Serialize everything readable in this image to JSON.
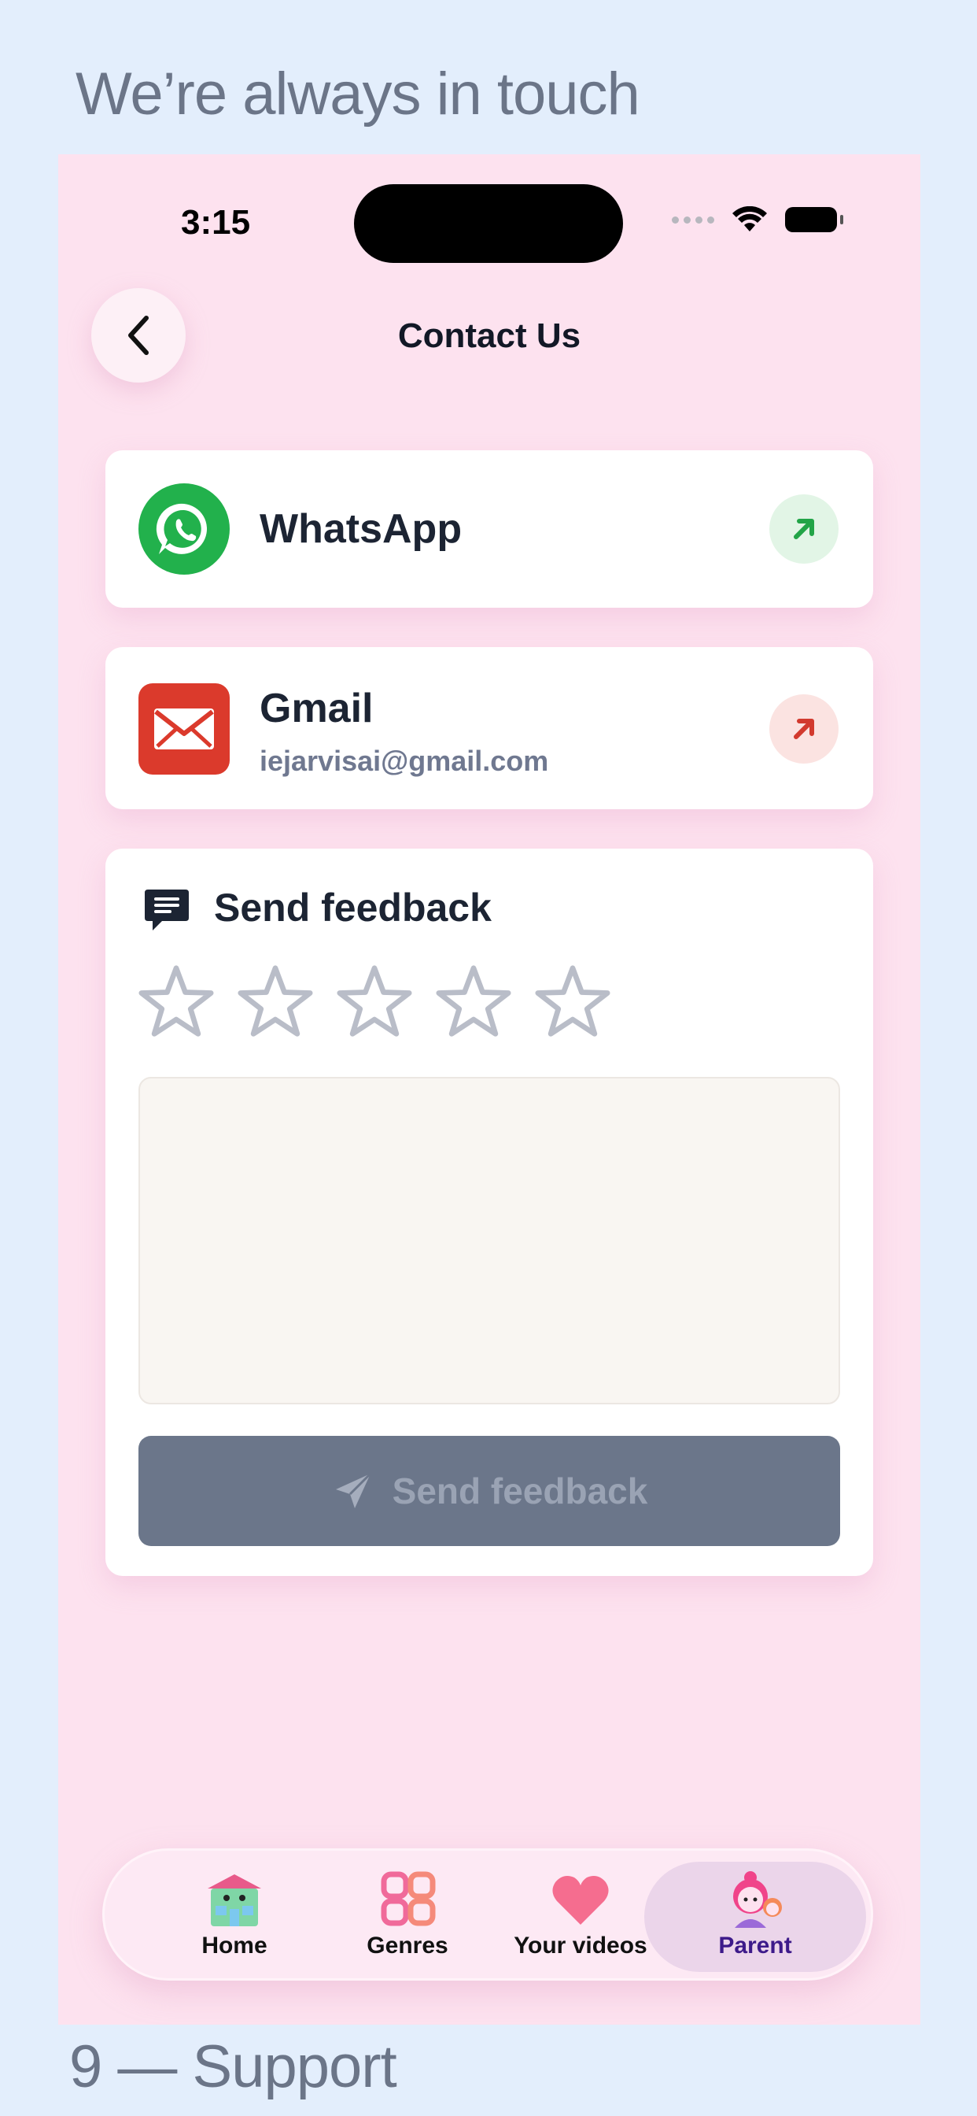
{
  "page": {
    "heading": "We’re always in touch",
    "footer": "9 — Support"
  },
  "status_bar": {
    "time": "3:15"
  },
  "header": {
    "title": "Contact Us"
  },
  "contacts": {
    "whatsapp": {
      "title": "WhatsApp",
      "color": "#22b14c"
    },
    "gmail": {
      "title": "Gmail",
      "email": "iejarvisai@gmail.com",
      "color": "#db3a2c"
    }
  },
  "feedback": {
    "title": "Send feedback",
    "rating": 0,
    "rating_max": 5,
    "text_value": "",
    "button_label": "Send feedback"
  },
  "tabbar": {
    "tabs": [
      {
        "label": "Home",
        "icon": "home-icon"
      },
      {
        "label": "Genres",
        "icon": "genres-icon"
      },
      {
        "label": "Your videos",
        "icon": "heart-icon"
      },
      {
        "label": "Parent",
        "icon": "parent-icon",
        "selected": true
      }
    ]
  },
  "colors": {
    "background": "#e3eefc",
    "screen": "#fde2ef",
    "accent_parent": "#3d1a8a",
    "button_disabled": "#6b768a"
  }
}
